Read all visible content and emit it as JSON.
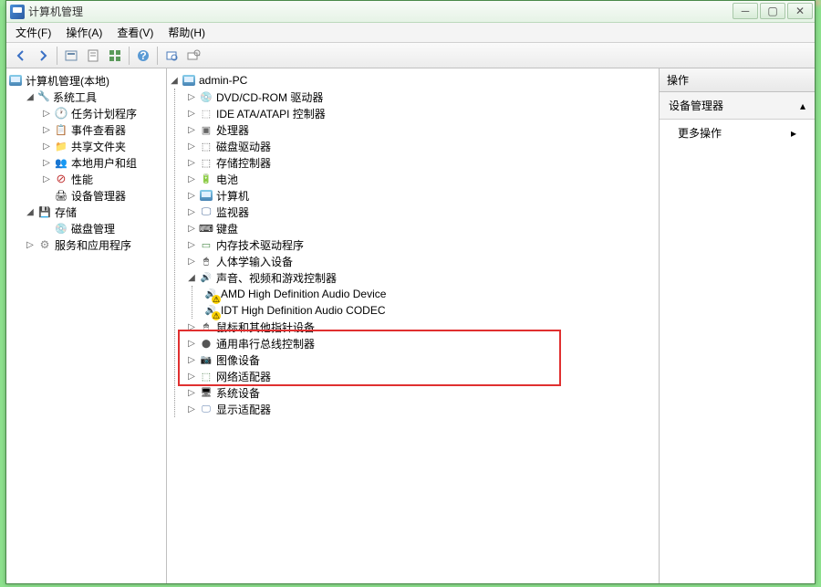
{
  "window": {
    "title": "计算机管理"
  },
  "menu": {
    "file": "文件(F)",
    "action": "操作(A)",
    "view": "查看(V)",
    "help": "帮助(H)"
  },
  "left_tree": {
    "root": "计算机管理(本地)",
    "system_tools": "系统工具",
    "task_scheduler": "任务计划程序",
    "event_viewer": "事件查看器",
    "shared_folders": "共享文件夹",
    "local_users": "本地用户和组",
    "performance": "性能",
    "device_manager": "设备管理器",
    "storage": "存储",
    "disk_mgmt": "磁盘管理",
    "services_apps": "服务和应用程序"
  },
  "mid_tree": {
    "root": "admin-PC",
    "dvd": "DVD/CD-ROM 驱动器",
    "ide": "IDE ATA/ATAPI 控制器",
    "cpu": "处理器",
    "disk_drives": "磁盘驱动器",
    "storage_ctrl": "存储控制器",
    "battery": "电池",
    "computer": "计算机",
    "monitor": "监视器",
    "keyboard": "键盘",
    "memory": "内存技术驱动程序",
    "hid": "人体学输入设备",
    "sound": "声音、视频和游戏控制器",
    "sound_amd": "AMD High Definition Audio Device",
    "sound_idt": "IDT High Definition Audio CODEC",
    "mouse": "鼠标和其他指针设备",
    "usb": "通用串行总线控制器",
    "imaging": "图像设备",
    "network": "网络适配器",
    "system_dev": "系统设备",
    "display": "显示适配器"
  },
  "actions": {
    "header": "操作",
    "section": "设备管理器",
    "more": "更多操作"
  }
}
